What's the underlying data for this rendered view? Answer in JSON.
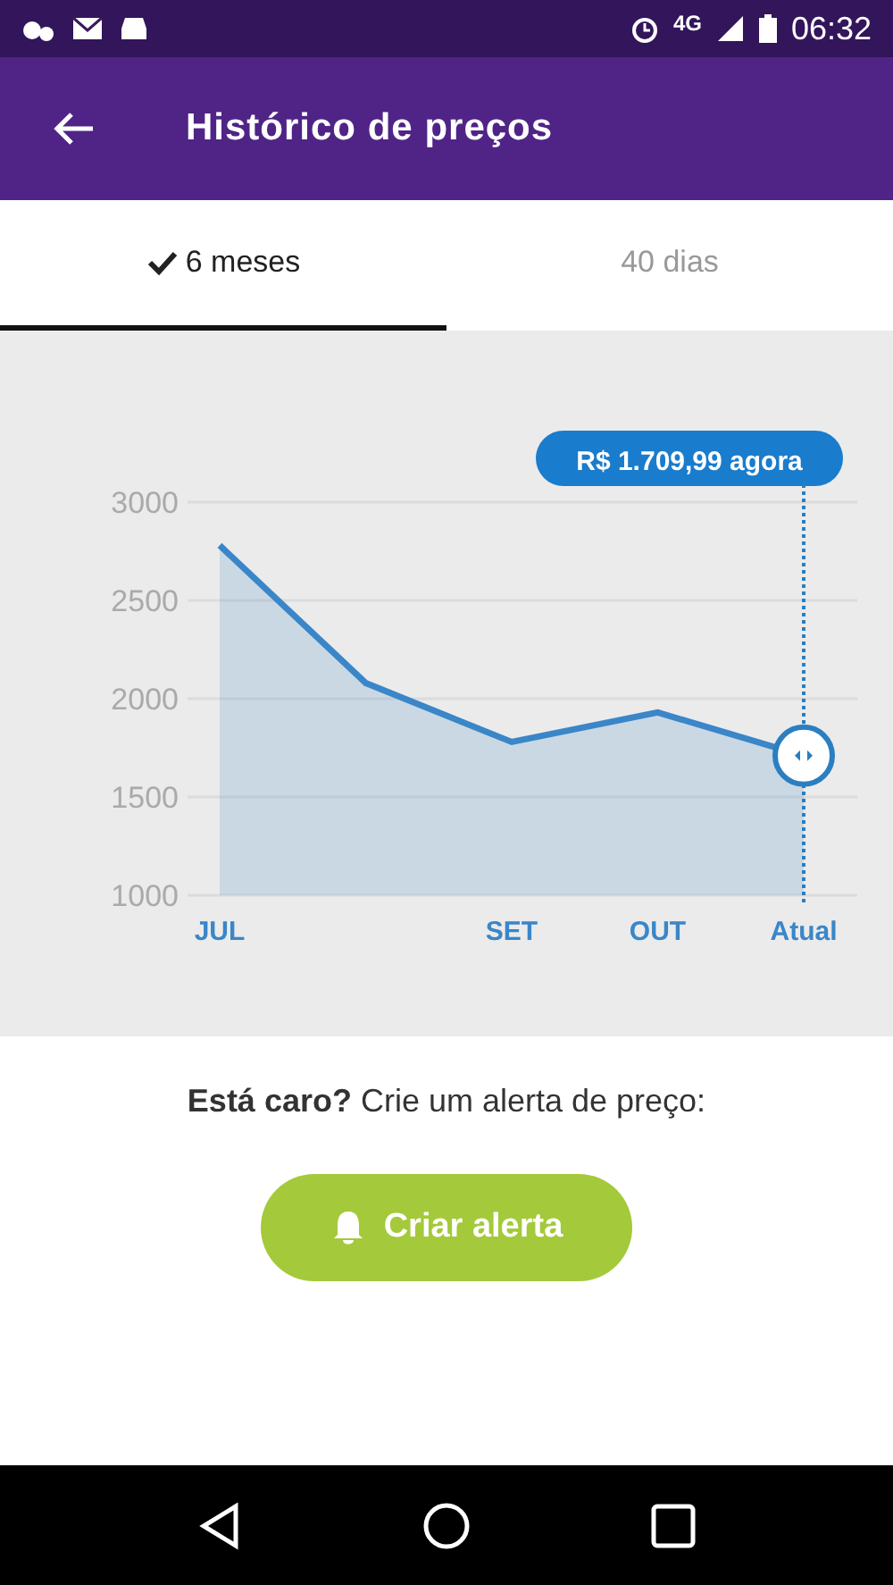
{
  "status_bar": {
    "network": "4G",
    "time": "06:32"
  },
  "app_bar": {
    "title": "Histórico de preços"
  },
  "tabs": [
    {
      "label": "6 meses",
      "selected": true
    },
    {
      "label": "40 dias",
      "selected": false
    }
  ],
  "chart_data": {
    "type": "area",
    "categories": [
      "JUL",
      null,
      "SET",
      "OUT",
      "Atual"
    ],
    "series": [
      {
        "color": "#3a86c8",
        "values": [
          2780,
          2080,
          1780,
          1930,
          1710
        ]
      }
    ],
    "ylim": [
      1000,
      3000
    ],
    "yticks": [
      1000,
      1500,
      2000,
      2500,
      3000
    ],
    "grid": true,
    "annotations": [
      "R$ 1.709,99 agora"
    ]
  },
  "alert": {
    "prompt": "**Está caro?** Crie um alerta de preço:",
    "button": "Criar alerta"
  }
}
